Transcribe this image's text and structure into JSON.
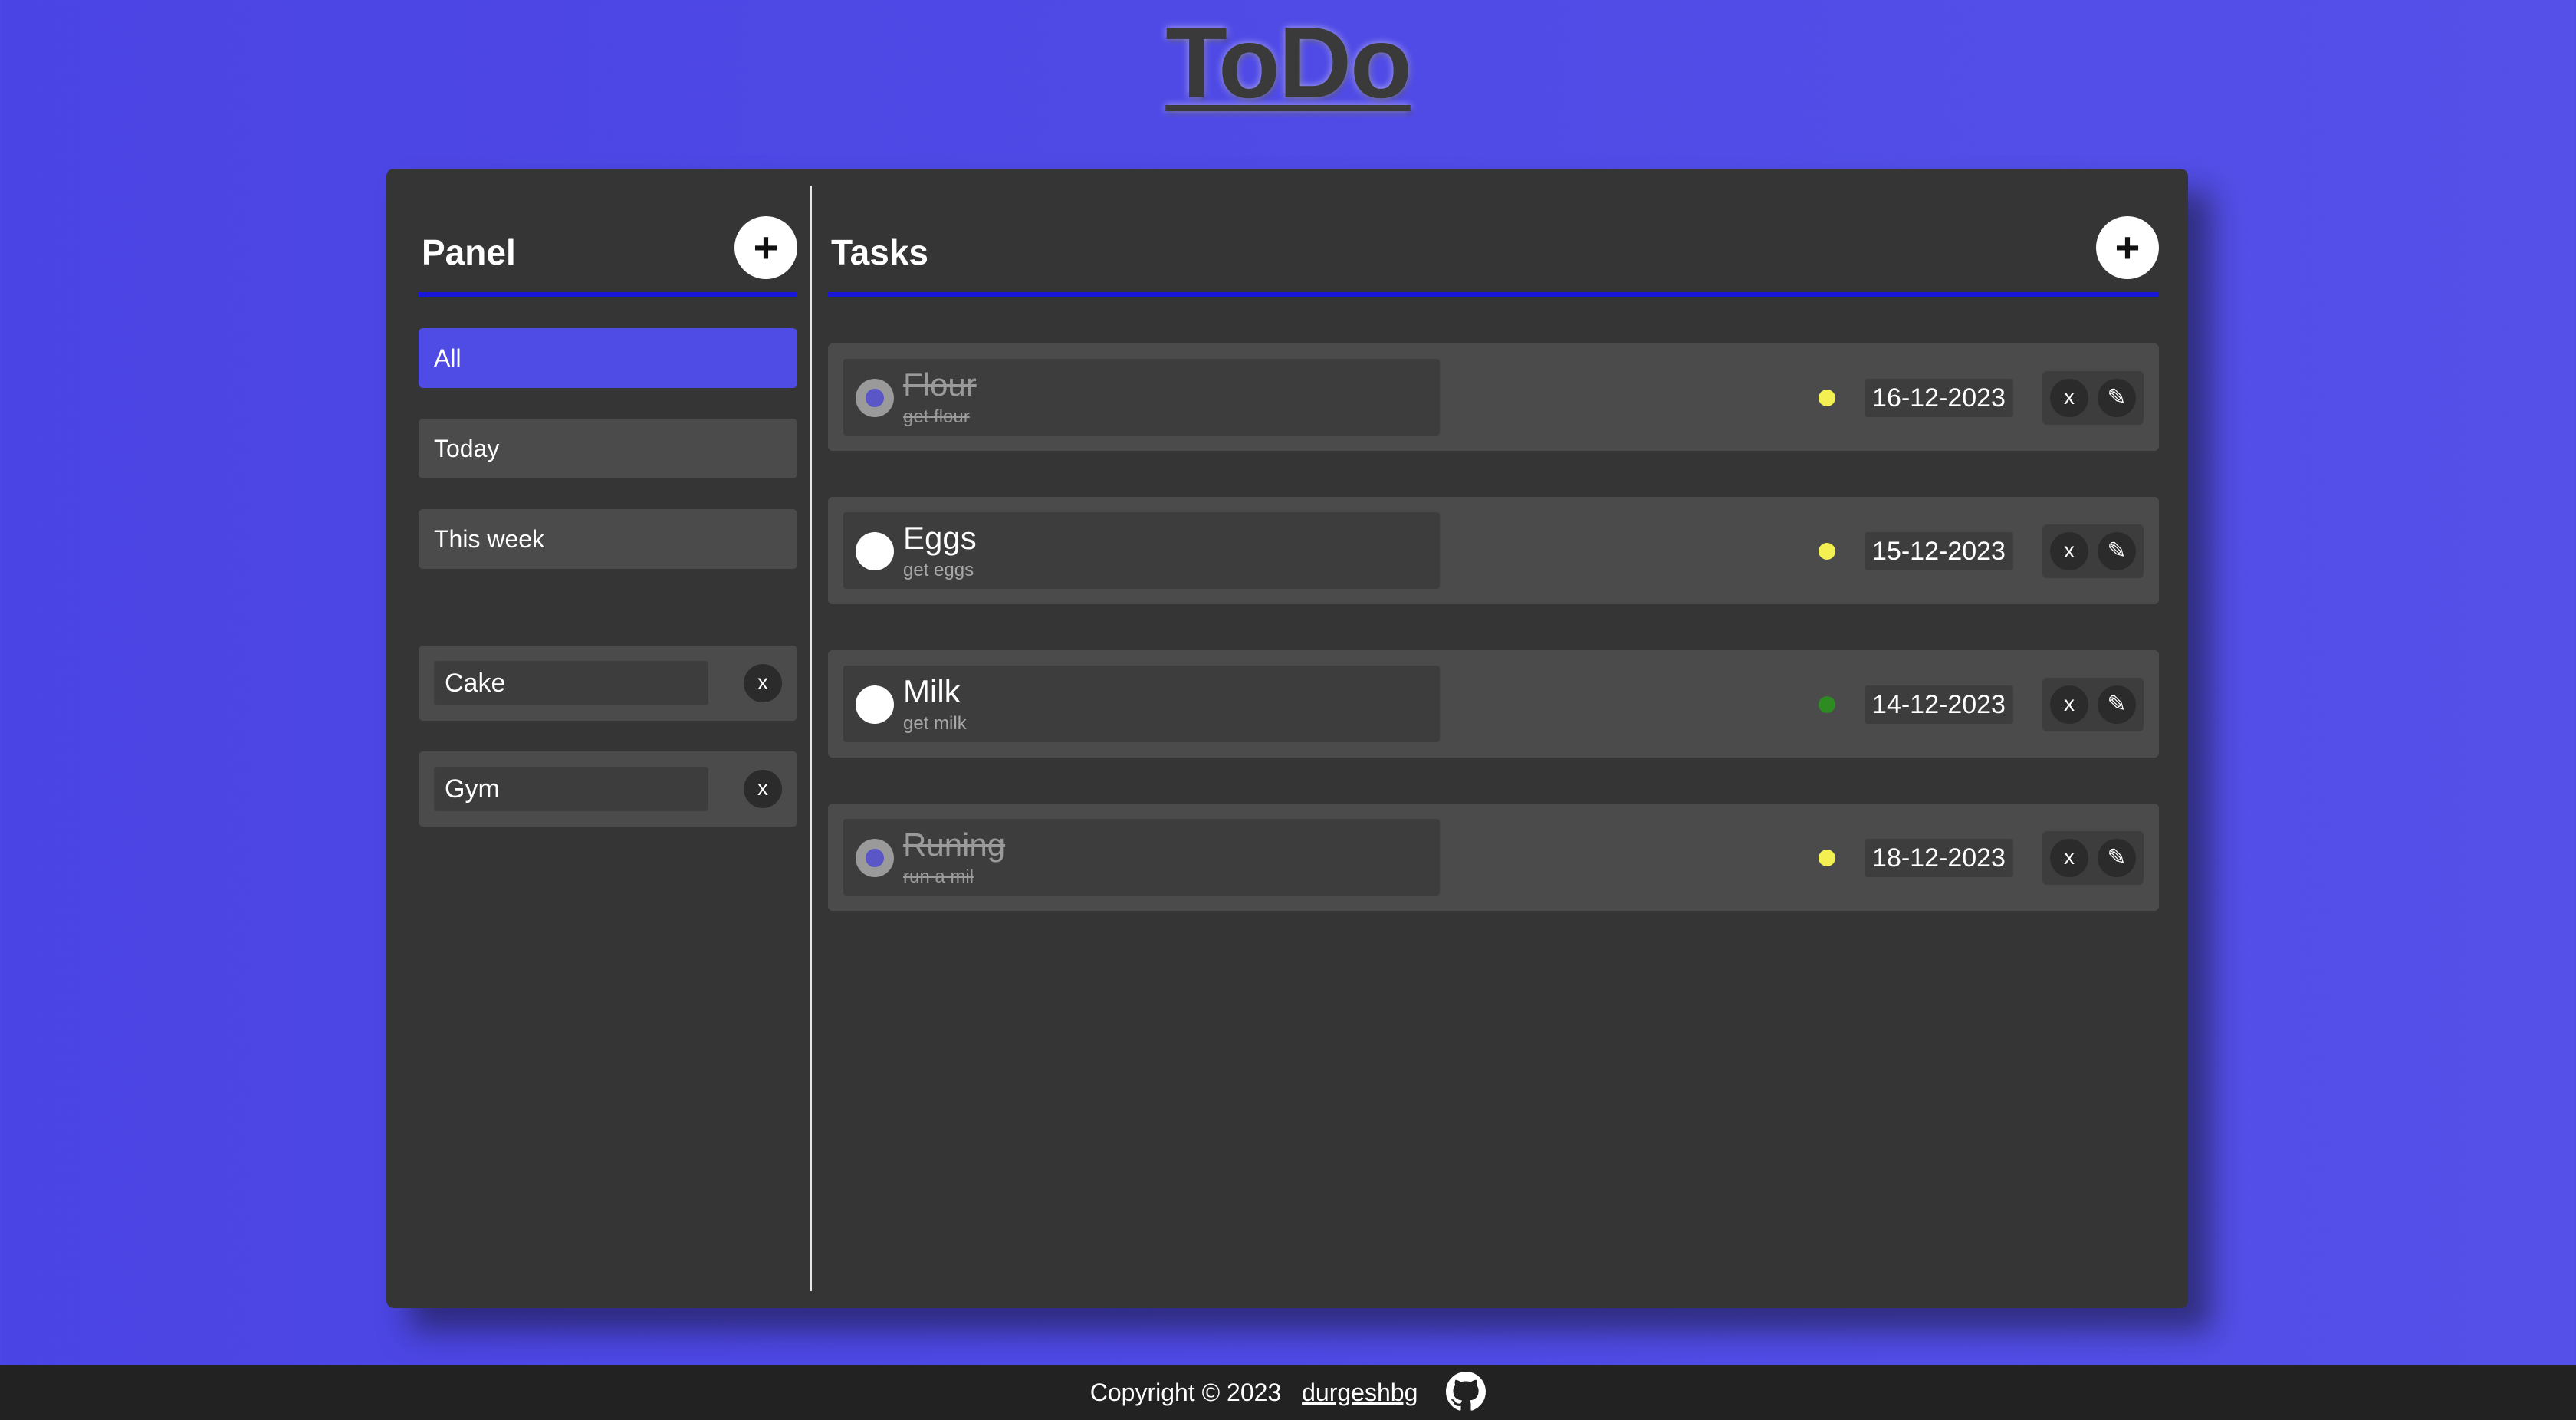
{
  "app": {
    "title": "ToDo"
  },
  "panel": {
    "title": "Panel",
    "add_label": "+",
    "filters": [
      {
        "label": "All",
        "active": true
      },
      {
        "label": "Today",
        "active": false
      },
      {
        "label": "This week",
        "active": false
      }
    ],
    "projects": [
      {
        "name": "Cake",
        "delete_label": "x"
      },
      {
        "name": "Gym",
        "delete_label": "x"
      }
    ]
  },
  "tasks": {
    "title": "Tasks",
    "add_label": "+",
    "items": [
      {
        "title": "Flour",
        "description": "get flour",
        "date": "16-12-2023",
        "done": true,
        "priority_color": "#f5f052",
        "delete_label": "x",
        "edit_label": "✎"
      },
      {
        "title": "Eggs",
        "description": "get eggs",
        "date": "15-12-2023",
        "done": false,
        "priority_color": "#f5f052",
        "delete_label": "x",
        "edit_label": "✎"
      },
      {
        "title": "Milk",
        "description": "get milk",
        "date": "14-12-2023",
        "done": false,
        "priority_color": "#2e8b22",
        "delete_label": "x",
        "edit_label": "✎"
      },
      {
        "title": "Runing",
        "description": "run a mil",
        "date": "18-12-2023",
        "done": true,
        "priority_color": "#f5f052",
        "delete_label": "x",
        "edit_label": "✎"
      }
    ]
  },
  "footer": {
    "copyright": "Copyright © 2023",
    "author": "durgeshbg",
    "icon": "github-icon"
  },
  "colors": {
    "accent": "#4f4ce6",
    "underline": "#1a18d8",
    "background": "#4b44e4",
    "card": "#353535"
  }
}
